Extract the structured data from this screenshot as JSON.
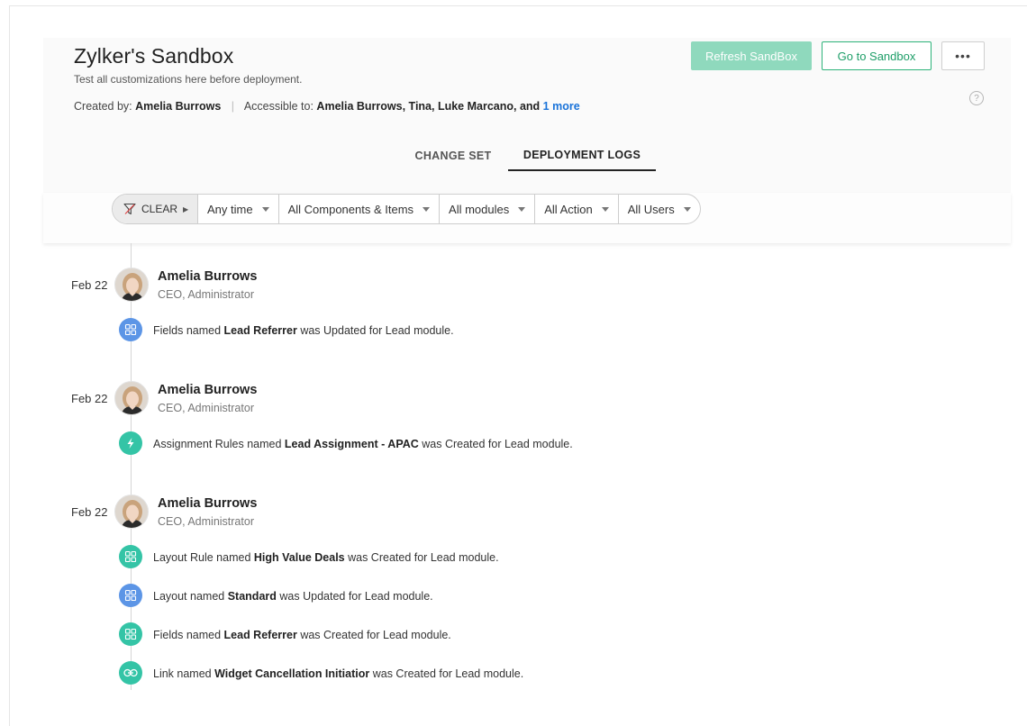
{
  "sandbox": {
    "title": "Zylker's Sandbox",
    "subtitle": "Test all customizations here before deployment.",
    "created_by_label": "Created by:",
    "created_by": "Amelia Burrows",
    "accessible_label": "Accessible to:",
    "accessible_to": "Amelia Burrows, Tina, Luke Marcano, and",
    "more_link": "1 more"
  },
  "actions": {
    "refresh_label": "Refresh SandBox",
    "goto_label": "Go to Sandbox",
    "more_label": "•••",
    "help_label": "?"
  },
  "tabs": {
    "change_set": "CHANGE SET",
    "deployment_logs": "DEPLOYMENT LOGS",
    "active": "DEPLOYMENT LOGS"
  },
  "filters": {
    "clear_label": "CLEAR",
    "time": "Any time",
    "components": "All Components & Items",
    "modules": "All modules",
    "action": "All Action",
    "users": "All Users"
  },
  "colors": {
    "primary_green": "#2db37a",
    "refresh_disabled": "#8fd9bd",
    "icon_blue": "#5c95e6",
    "icon_teal": "#34c4a6",
    "link_blue": "#1a73d9"
  },
  "logs": [
    {
      "date": "Feb 22",
      "user": "Amelia Burrows",
      "role": "CEO, Administrator",
      "entries": [
        {
          "icon": "grid-icon",
          "color": "blue",
          "pre": "Fields named",
          "item": "Lead Referrer",
          "post": "was Updated for Lead module."
        }
      ]
    },
    {
      "date": "Feb 22",
      "user": "Amelia Burrows",
      "role": "CEO, Administrator",
      "entries": [
        {
          "icon": "lightning-icon",
          "color": "teal",
          "pre": "Assignment Rules named",
          "item": "Lead Assignment - APAC",
          "post": "was Created for Lead module."
        }
      ]
    },
    {
      "date": "Feb 22",
      "user": "Amelia Burrows",
      "role": "CEO, Administrator",
      "entries": [
        {
          "icon": "grid-icon",
          "color": "teal",
          "pre": "Layout Rule named",
          "item": "High Value Deals",
          "post": "was Created for Lead module."
        },
        {
          "icon": "grid-icon",
          "color": "blue",
          "pre": "Layout named",
          "item": "Standard",
          "post": "was Updated for Lead module."
        },
        {
          "icon": "grid-icon",
          "color": "teal",
          "pre": "Fields named",
          "item": "Lead Referrer",
          "post": "was Created for Lead module."
        },
        {
          "icon": "link-icon",
          "color": "teal",
          "pre": "Link named",
          "item": "Widget Cancellation Initiatior",
          "post": "was Created for Lead module."
        }
      ]
    }
  ]
}
